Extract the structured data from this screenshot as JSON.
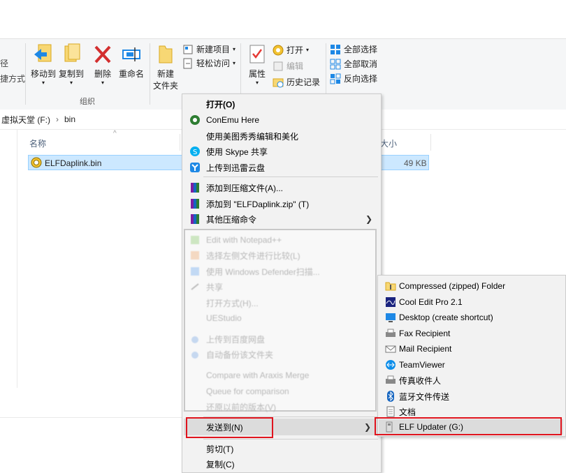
{
  "ribbon": {
    "partial_left_label_1": "径",
    "partial_left_label_2": "捷方式",
    "move_to": "移动到",
    "copy_to": "复制到",
    "delete": "删除",
    "rename": "重命名",
    "organize_group": "组织",
    "new_folder_line1": "新建",
    "new_folder_line2": "文件夹",
    "new_item": "新建项目",
    "easy_access": "轻松访问",
    "properties": "属性",
    "open": "打开",
    "edit": "编辑",
    "history": "历史记录",
    "select_all": "全部选择",
    "select_none": "全部取消",
    "invert_selection": "反向选择"
  },
  "address": {
    "drive": "虚拟天堂 (F:)",
    "separator": "›",
    "folder": "bin"
  },
  "columns": {
    "name": "名称",
    "size": "大小"
  },
  "file": {
    "name": "ELFDaplink.bin",
    "size": "49 KB"
  },
  "context_menu": {
    "items": [
      {
        "label": "打开(O)",
        "bold": true
      },
      {
        "label": "ConEmu Here"
      },
      {
        "label": "使用美图秀秀编辑和美化"
      },
      {
        "label": "使用 Skype 共享"
      },
      {
        "label": "上传到迅雷云盘"
      },
      {
        "label": "添加到压缩文件(A)..."
      },
      {
        "label": "添加到 \"ELFDaplink.zip\" (T)"
      },
      {
        "label": "其他压缩命令"
      },
      {
        "label": "Edit with Notepad++"
      },
      {
        "label": "选择左侧文件进行比较(L)"
      },
      {
        "label": "使用 Windows Defender扫描..."
      },
      {
        "label": "共享"
      },
      {
        "label": "打开方式(H)..."
      },
      {
        "label": "UEStudio"
      },
      {
        "label": "上传到百度网盘"
      },
      {
        "label": "自动备份该文件夹"
      },
      {
        "label": "Compare with Araxis Merge"
      },
      {
        "label": "Queue for comparison"
      },
      {
        "label": "还原以前的版本(V)"
      },
      {
        "label": "发送到(N)"
      },
      {
        "label": "剪切(T)"
      },
      {
        "label": "复制(C)"
      }
    ]
  },
  "send_to_menu": {
    "items": [
      {
        "label": "Compressed (zipped) Folder"
      },
      {
        "label": "Cool Edit Pro 2.1"
      },
      {
        "label": "Desktop (create shortcut)"
      },
      {
        "label": "Fax Recipient"
      },
      {
        "label": "Mail Recipient"
      },
      {
        "label": "TeamViewer"
      },
      {
        "label": "传真收件人"
      },
      {
        "label": "蓝牙文件传送"
      },
      {
        "label": "文档"
      },
      {
        "label": "ELF Updater (G:)"
      }
    ]
  },
  "colors": {
    "highlight_red": "#e0141e",
    "selection_blue": "#cce8ff"
  }
}
